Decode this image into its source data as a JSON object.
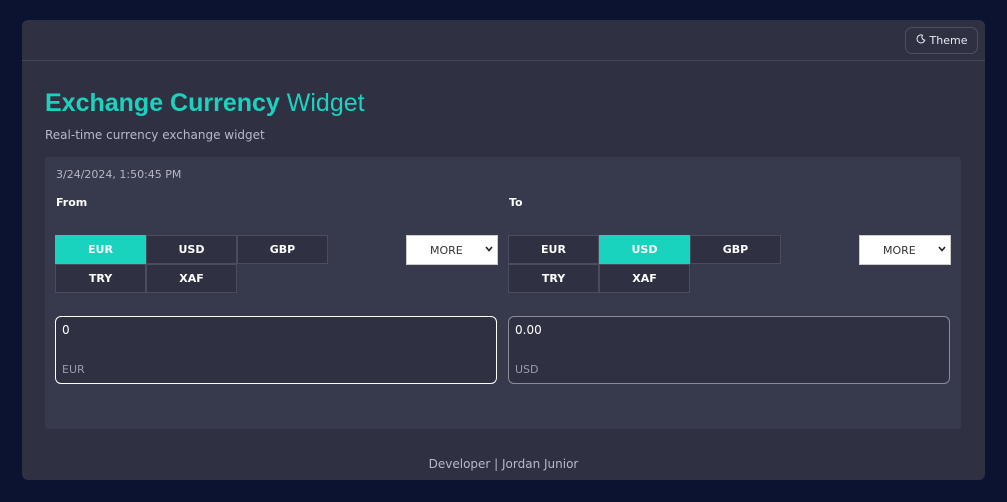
{
  "header": {
    "theme_label": "Theme",
    "theme_icon": "moon-icon"
  },
  "title": {
    "bold": "Exchange Currency",
    "light": "Widget"
  },
  "subtitle": "Real-time currency exchange widget",
  "timestamp": "3/24/2024, 1:50:45 PM",
  "from": {
    "label": "From",
    "currencies": [
      "EUR",
      "USD",
      "GBP",
      "TRY",
      "XAF"
    ],
    "selected": "EUR",
    "more_label": "MORE",
    "amount": "0",
    "code": "EUR"
  },
  "to": {
    "label": "To",
    "currencies": [
      "EUR",
      "USD",
      "GBP",
      "TRY",
      "XAF"
    ],
    "selected": "USD",
    "more_label": "MORE",
    "amount": "0.00",
    "code": "USD"
  },
  "footer": "Developer | Jordan Junior",
  "colors": {
    "accent": "#19d3be",
    "background": "#0c1330",
    "card": "#2f3143",
    "panel": "#373a4c"
  }
}
